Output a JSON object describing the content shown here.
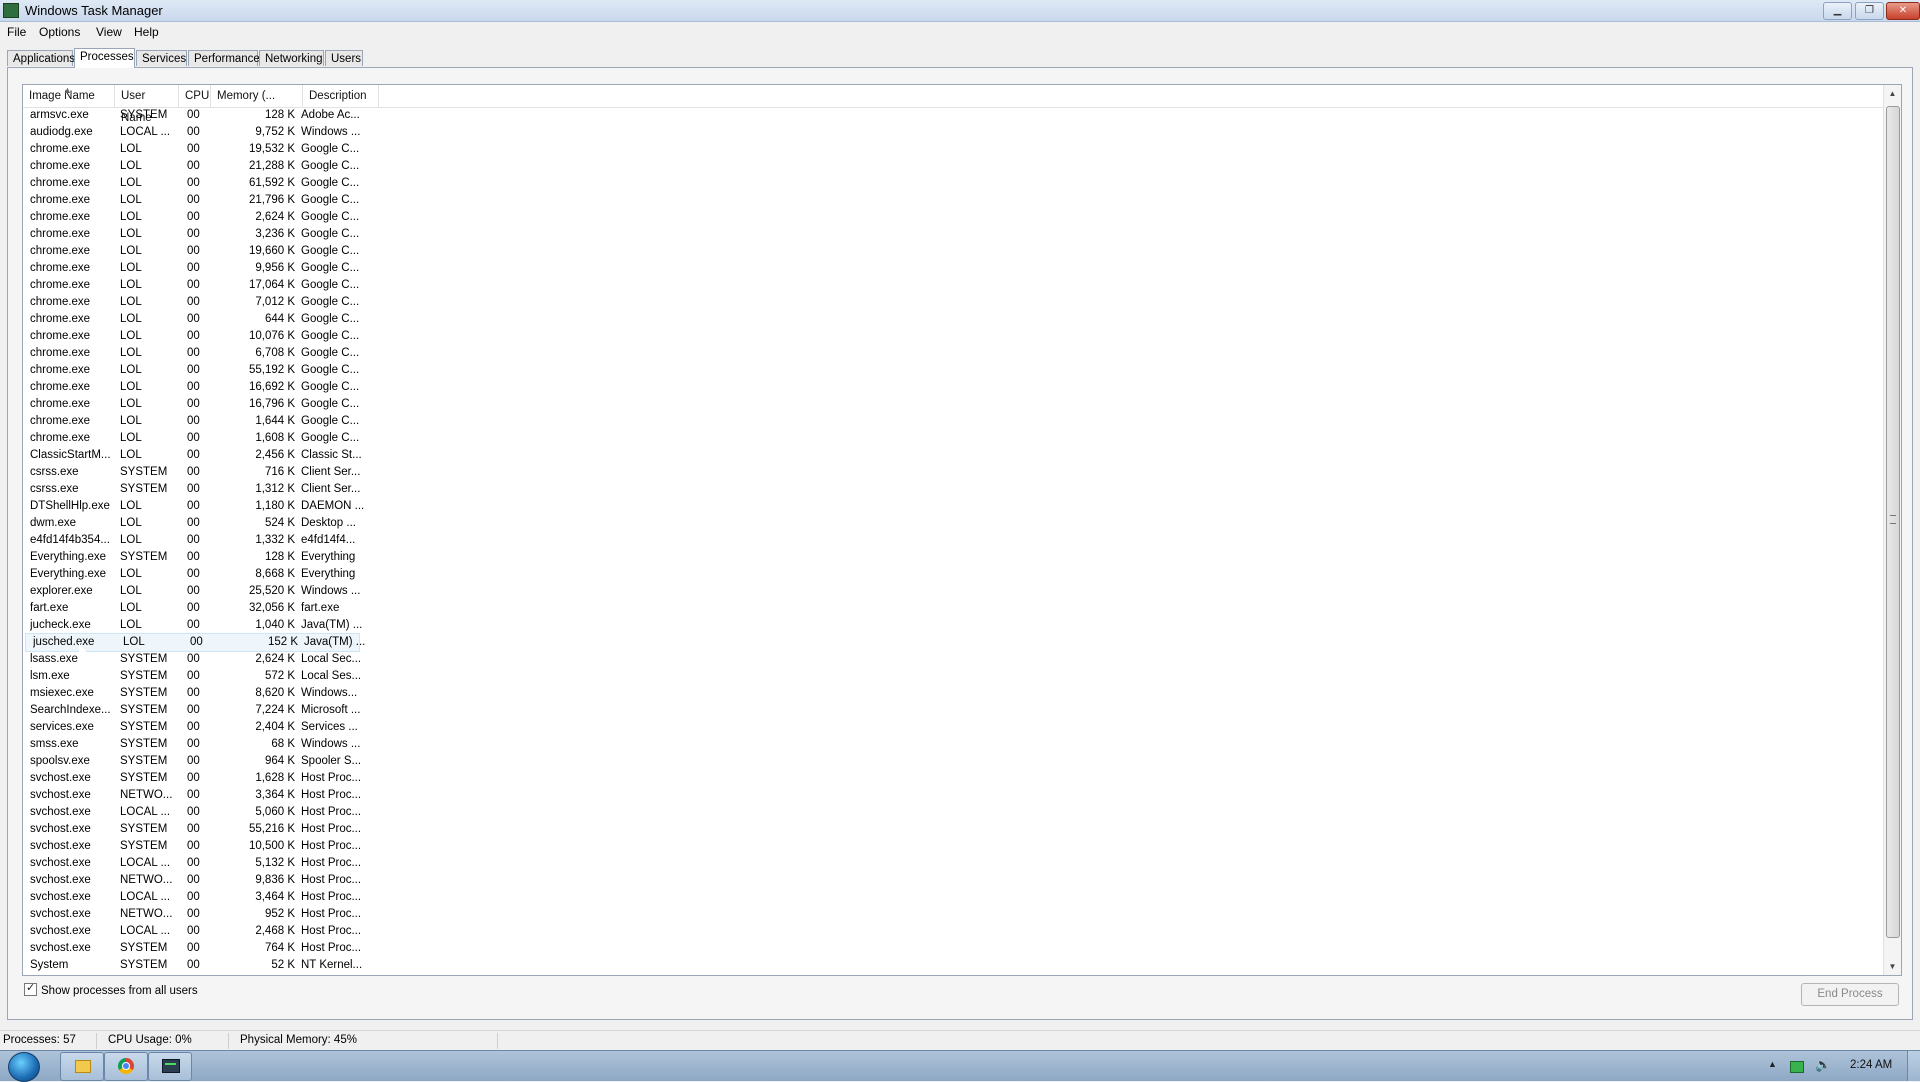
{
  "window": {
    "title": "Windows Task Manager"
  },
  "menu": [
    "File",
    "Options",
    "View",
    "Help"
  ],
  "tabs": [
    {
      "label": "Applications",
      "active": false
    },
    {
      "label": "Processes",
      "active": true
    },
    {
      "label": "Services",
      "active": false
    },
    {
      "label": "Performance",
      "active": false
    },
    {
      "label": "Networking",
      "active": false
    },
    {
      "label": "Users",
      "active": false
    }
  ],
  "columns": [
    "Image Name",
    "User Name",
    "CPU",
    "Memory (...",
    "Description"
  ],
  "processes": [
    [
      "armsvc.exe",
      "SYSTEM",
      "00",
      "128 K",
      "Adobe Ac..."
    ],
    [
      "audiodg.exe",
      "LOCAL ...",
      "00",
      "9,752 K",
      "Windows ..."
    ],
    [
      "chrome.exe",
      "LOL",
      "00",
      "19,532 K",
      "Google C..."
    ],
    [
      "chrome.exe",
      "LOL",
      "00",
      "21,288 K",
      "Google C..."
    ],
    [
      "chrome.exe",
      "LOL",
      "00",
      "61,592 K",
      "Google C..."
    ],
    [
      "chrome.exe",
      "LOL",
      "00",
      "21,796 K",
      "Google C..."
    ],
    [
      "chrome.exe",
      "LOL",
      "00",
      "2,624 K",
      "Google C..."
    ],
    [
      "chrome.exe",
      "LOL",
      "00",
      "3,236 K",
      "Google C..."
    ],
    [
      "chrome.exe",
      "LOL",
      "00",
      "19,660 K",
      "Google C..."
    ],
    [
      "chrome.exe",
      "LOL",
      "00",
      "9,956 K",
      "Google C..."
    ],
    [
      "chrome.exe",
      "LOL",
      "00",
      "17,064 K",
      "Google C..."
    ],
    [
      "chrome.exe",
      "LOL",
      "00",
      "7,012 K",
      "Google C..."
    ],
    [
      "chrome.exe",
      "LOL",
      "00",
      "644 K",
      "Google C..."
    ],
    [
      "chrome.exe",
      "LOL",
      "00",
      "10,076 K",
      "Google C..."
    ],
    [
      "chrome.exe",
      "LOL",
      "00",
      "6,708 K",
      "Google C..."
    ],
    [
      "chrome.exe",
      "LOL",
      "00",
      "55,192 K",
      "Google C..."
    ],
    [
      "chrome.exe",
      "LOL",
      "00",
      "16,692 K",
      "Google C..."
    ],
    [
      "chrome.exe",
      "LOL",
      "00",
      "16,796 K",
      "Google C..."
    ],
    [
      "chrome.exe",
      "LOL",
      "00",
      "1,644 K",
      "Google C..."
    ],
    [
      "chrome.exe",
      "LOL",
      "00",
      "1,608 K",
      "Google C..."
    ],
    [
      "ClassicStartM...",
      "LOL",
      "00",
      "2,456 K",
      "Classic St..."
    ],
    [
      "csrss.exe",
      "SYSTEM",
      "00",
      "716 K",
      "Client Ser..."
    ],
    [
      "csrss.exe",
      "SYSTEM",
      "00",
      "1,312 K",
      "Client Ser..."
    ],
    [
      "DTShellHlp.exe",
      "LOL",
      "00",
      "1,180 K",
      "DAEMON ..."
    ],
    [
      "dwm.exe",
      "LOL",
      "00",
      "524 K",
      "Desktop ..."
    ],
    [
      "e4fd14f4b354...",
      "LOL",
      "00",
      "1,332 K",
      "e4fd14f4..."
    ],
    [
      "Everything.exe",
      "SYSTEM",
      "00",
      "128 K",
      "Everything"
    ],
    [
      "Everything.exe",
      "LOL",
      "00",
      "8,668 K",
      "Everything"
    ],
    [
      "explorer.exe",
      "LOL",
      "00",
      "25,520 K",
      "Windows ..."
    ],
    [
      "fart.exe",
      "LOL",
      "00",
      "32,056 K",
      "fart.exe"
    ],
    [
      "jucheck.exe",
      "LOL",
      "00",
      "1,040 K",
      "Java(TM) ..."
    ],
    [
      "jusched.exe",
      "LOL",
      "00",
      "152 K",
      "Java(TM) ..."
    ],
    [
      "lsass.exe",
      "SYSTEM",
      "00",
      "2,624 K",
      "Local Sec..."
    ],
    [
      "lsm.exe",
      "SYSTEM",
      "00",
      "572 K",
      "Local Ses..."
    ],
    [
      "msiexec.exe",
      "SYSTEM",
      "00",
      "8,620 K",
      "Windows..."
    ],
    [
      "SearchIndexe...",
      "SYSTEM",
      "00",
      "7,224 K",
      "Microsoft ..."
    ],
    [
      "services.exe",
      "SYSTEM",
      "00",
      "2,404 K",
      "Services ..."
    ],
    [
      "smss.exe",
      "SYSTEM",
      "00",
      "68 K",
      "Windows ..."
    ],
    [
      "spoolsv.exe",
      "SYSTEM",
      "00",
      "964 K",
      "Spooler S..."
    ],
    [
      "svchost.exe",
      "SYSTEM",
      "00",
      "1,628 K",
      "Host Proc..."
    ],
    [
      "svchost.exe",
      "NETWO...",
      "00",
      "3,364 K",
      "Host Proc..."
    ],
    [
      "svchost.exe",
      "LOCAL ...",
      "00",
      "5,060 K",
      "Host Proc..."
    ],
    [
      "svchost.exe",
      "SYSTEM",
      "00",
      "55,216 K",
      "Host Proc..."
    ],
    [
      "svchost.exe",
      "SYSTEM",
      "00",
      "10,500 K",
      "Host Proc..."
    ],
    [
      "svchost.exe",
      "LOCAL ...",
      "00",
      "5,132 K",
      "Host Proc..."
    ],
    [
      "svchost.exe",
      "NETWO...",
      "00",
      "9,836 K",
      "Host Proc..."
    ],
    [
      "svchost.exe",
      "LOCAL ...",
      "00",
      "3,464 K",
      "Host Proc..."
    ],
    [
      "svchost.exe",
      "NETWO...",
      "00",
      "952 K",
      "Host Proc..."
    ],
    [
      "svchost.exe",
      "LOCAL ...",
      "00",
      "2,468 K",
      "Host Proc..."
    ],
    [
      "svchost.exe",
      "SYSTEM",
      "00",
      "764 K",
      "Host Proc..."
    ],
    [
      "System",
      "SYSTEM",
      "00",
      "52 K",
      "NT Kernel..."
    ]
  ],
  "hovered_row": 31,
  "controls": {
    "show_all_label": "Show processes from all users",
    "show_all_checked": true,
    "end_process_label": "End Process"
  },
  "status": {
    "processes": "Processes: 57",
    "cpu": "CPU Usage: 0%",
    "memory": "Physical Memory: 45%"
  },
  "taskbar": {
    "items": [
      "folder-icon",
      "chrome-icon",
      "task-manager-icon"
    ],
    "clock": "2:24 AM"
  }
}
